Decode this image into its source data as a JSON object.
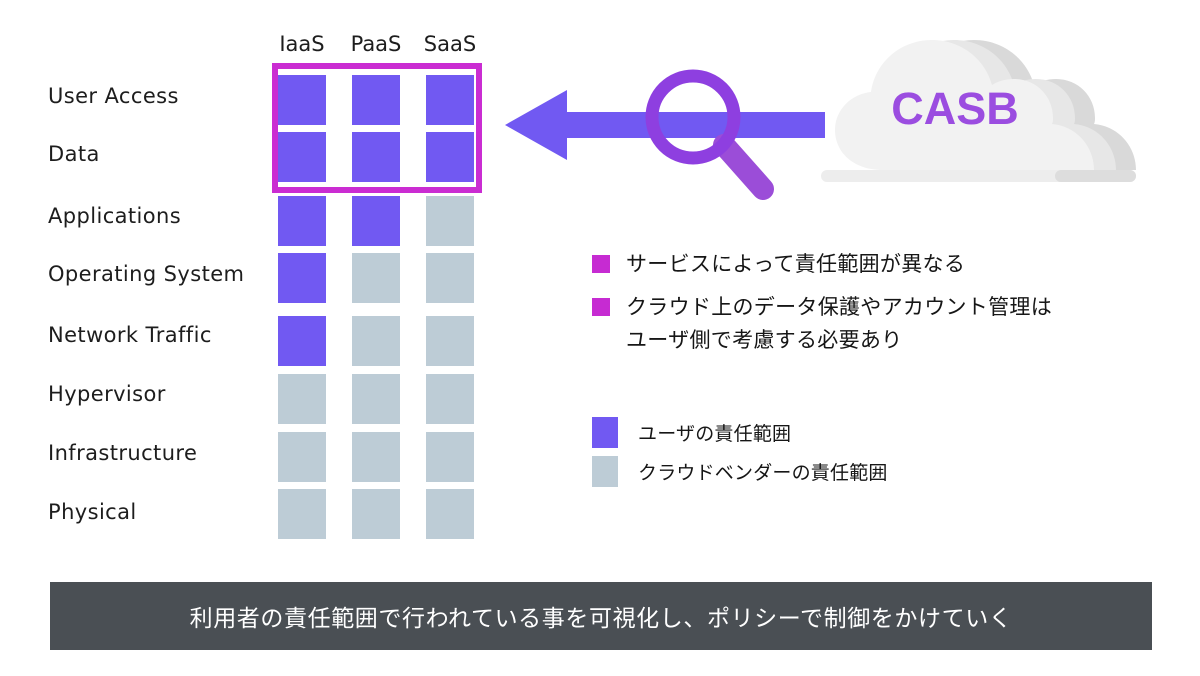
{
  "matrix": {
    "columns": [
      "IaaS",
      "PaaS",
      "SaaS"
    ],
    "rows": [
      "User Access",
      "Data",
      "Applications",
      "Operating System",
      "Network Traffic",
      "Hypervisor",
      "Infrastructure",
      "Physical"
    ],
    "ownership": [
      [
        "user",
        "user",
        "user"
      ],
      [
        "user",
        "user",
        "user"
      ],
      [
        "user",
        "user",
        "vendor"
      ],
      [
        "user",
        "vendor",
        "vendor"
      ],
      [
        "user",
        "vendor",
        "vendor"
      ],
      [
        "vendor",
        "vendor",
        "vendor"
      ],
      [
        "vendor",
        "vendor",
        "vendor"
      ],
      [
        "vendor",
        "vendor",
        "vendor"
      ]
    ],
    "highlight_rows": [
      "User Access",
      "Data"
    ],
    "highlight_color": "#CA2CD2"
  },
  "flow": {
    "cloud_label": "CASB",
    "cloud_label_color": "#9B4DE0",
    "arrow_color": "#7159F2",
    "magnifier_color": "#9B4DD8",
    "arrow_icon": "left-arrow-icon",
    "magnifier_icon": "magnifier-icon",
    "cloud_icon": "cloud-icon"
  },
  "notes": {
    "bullet_color": "#C62BD2",
    "items": [
      "サービスによって責任範囲が異なる",
      "クラウド上のデータ保護やアカウント管理は\nユーザ側で考慮する必要あり"
    ]
  },
  "key": {
    "items": [
      {
        "label": "ユーザの責任範囲",
        "color": "#7159F2",
        "kind": "user"
      },
      {
        "label": "クラウドベンダーの責任範囲",
        "color": "#BDCCD6",
        "kind": "vendor"
      }
    ]
  },
  "caption": {
    "text": "利用者の責任範囲で行われている事を可視化し、ポリシーで制御をかけていく",
    "background": "#4A4F54",
    "text_color": "#FFFFFF"
  },
  "chart_data": {
    "type": "heatmap",
    "title": "",
    "xlabel": "",
    "ylabel": "",
    "categories": [
      "IaaS",
      "PaaS",
      "SaaS"
    ],
    "rows": [
      "User Access",
      "Data",
      "Applications",
      "Operating System",
      "Network Traffic",
      "Hypervisor",
      "Infrastructure",
      "Physical"
    ],
    "values": [
      [
        1,
        1,
        1
      ],
      [
        1,
        1,
        1
      ],
      [
        1,
        1,
        0
      ],
      [
        1,
        0,
        0
      ],
      [
        1,
        0,
        0
      ],
      [
        0,
        0,
        0
      ],
      [
        0,
        0,
        0
      ],
      [
        0,
        0,
        0
      ]
    ],
    "value_meaning": {
      "1": "ユーザの責任範囲",
      "0": "クラウドベンダーの責任範囲"
    },
    "legend": [
      "ユーザの責任範囲",
      "クラウドベンダーの責任範囲"
    ],
    "legend_position": "right",
    "grid": false,
    "annotations": [
      "CASB"
    ]
  }
}
